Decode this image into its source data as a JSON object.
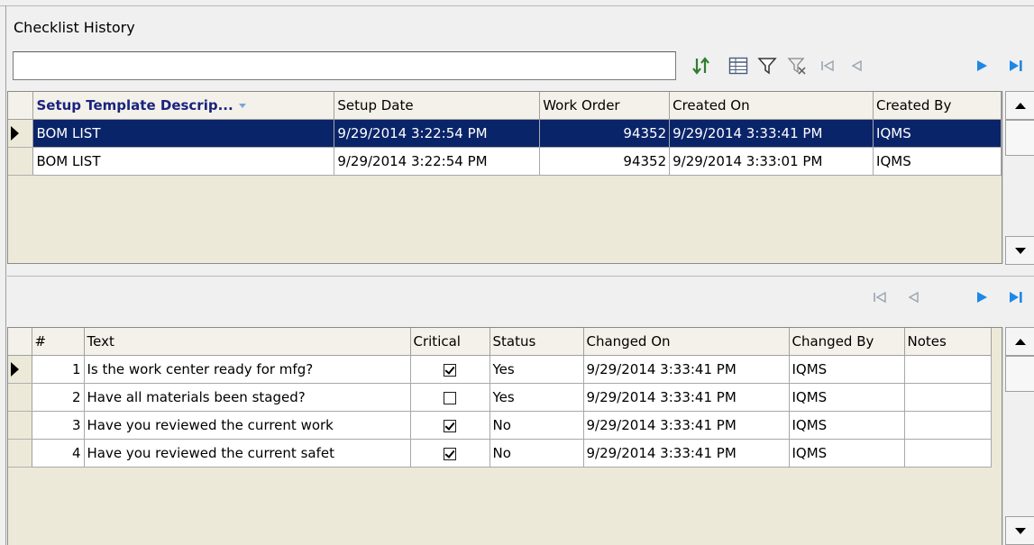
{
  "panel": {
    "title": "Checklist History",
    "search_value": "",
    "toolbar_icons": [
      "sort-icon",
      "columns-icon",
      "filter-icon",
      "clear-filter-icon",
      "first-record-icon",
      "prior-record-icon",
      "next-record-icon",
      "last-record-icon"
    ]
  },
  "history_grid": {
    "columns": [
      "Setup Template Descrip...",
      "Setup Date",
      "Work Order",
      "Created On",
      "Created By"
    ],
    "rows": [
      {
        "template": "BOM LIST",
        "setup_date": "9/29/2014 3:22:54 PM",
        "work_order": "94352",
        "created_on": "9/29/2014 3:33:41 PM",
        "created_by": "IQMS",
        "selected": true
      },
      {
        "template": "BOM LIST",
        "setup_date": "9/29/2014 3:22:54 PM",
        "work_order": "94352",
        "created_on": "9/29/2014 3:33:01 PM",
        "created_by": "IQMS",
        "selected": false
      }
    ]
  },
  "detail_nav_icons": [
    "first-record-icon",
    "prior-record-icon",
    "next-record-icon",
    "last-record-icon"
  ],
  "detail_grid": {
    "columns": [
      "#",
      "Text",
      "Critical",
      "Status",
      "Changed On",
      "Changed By",
      "Notes"
    ],
    "rows": [
      {
        "num": "1",
        "text": "Is the work center ready for mfg?",
        "critical": true,
        "status": "Yes",
        "changed_on": "9/29/2014 3:33:41 PM",
        "changed_by": "IQMS",
        "notes": ""
      },
      {
        "num": "2",
        "text": "Have all materials been staged?",
        "critical": false,
        "status": "Yes",
        "changed_on": "9/29/2014 3:33:41 PM",
        "changed_by": "IQMS",
        "notes": ""
      },
      {
        "num": "3",
        "text": "Have you reviewed the current work",
        "critical": true,
        "status": "No",
        "changed_on": "9/29/2014 3:33:41 PM",
        "changed_by": "IQMS",
        "notes": ""
      },
      {
        "num": "4",
        "text": "Have you reviewed the current safet",
        "critical": true,
        "status": "No",
        "changed_on": "9/29/2014 3:33:41 PM",
        "changed_by": "IQMS",
        "notes": ""
      }
    ]
  },
  "colors": {
    "selection": "#0a246a",
    "nav_active": "#1e88e5",
    "nav_disabled": "#9aa3b0",
    "sort_icon": "#2e7d32"
  }
}
